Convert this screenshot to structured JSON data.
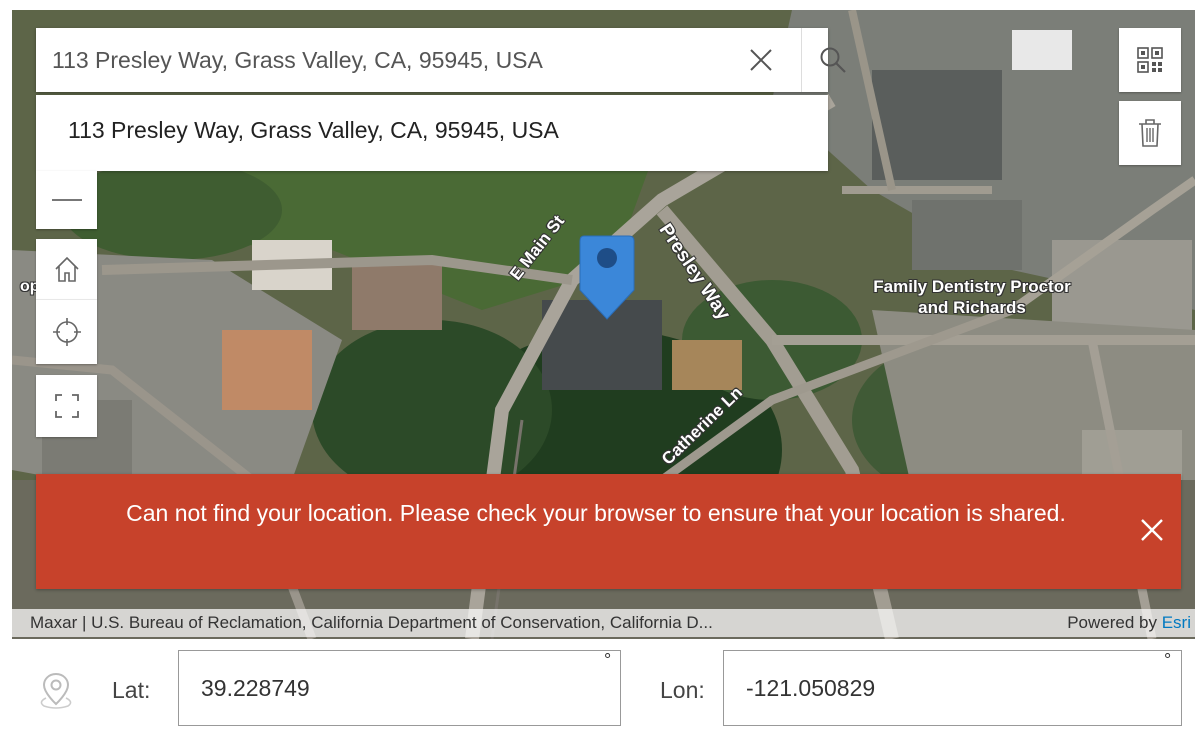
{
  "search": {
    "value": "113 Presley Way, Grass Valley, CA, 95945, USA",
    "suggestion": "113 Presley Way, Grass Valley, CA, 95945, USA"
  },
  "map": {
    "labels": {
      "e_main": "E Main St",
      "presley": "Presley Way",
      "catherine": "Catherine Ln",
      "dentistry": "Family Dentistry Proctor and Richards",
      "shop": "op"
    },
    "attribution": "Maxar | U.S. Bureau of Reclamation, California Department of Conservation, California D...",
    "powered_by": "Powered by",
    "esri": "Esri"
  },
  "controls": {
    "zoom_out_icon": "minus-icon",
    "home_icon": "home-icon",
    "locate_icon": "crosshair-icon",
    "fullscreen_icon": "fullscreen-icon",
    "qr_icon": "qr-code-icon",
    "trash_icon": "trash-icon"
  },
  "alert": {
    "message": "Can not find your location. Please check your browser to ensure that your location is shared."
  },
  "coordinates": {
    "lat_label": "Lat:",
    "lat_value": "39.228749",
    "lon_label": "Lon:",
    "lon_value": "-121.050829",
    "degree_symbol": "°"
  },
  "colors": {
    "alert_bg": "#c7422b",
    "marker": "#3b87d9",
    "esri_blue": "#0079c1"
  }
}
